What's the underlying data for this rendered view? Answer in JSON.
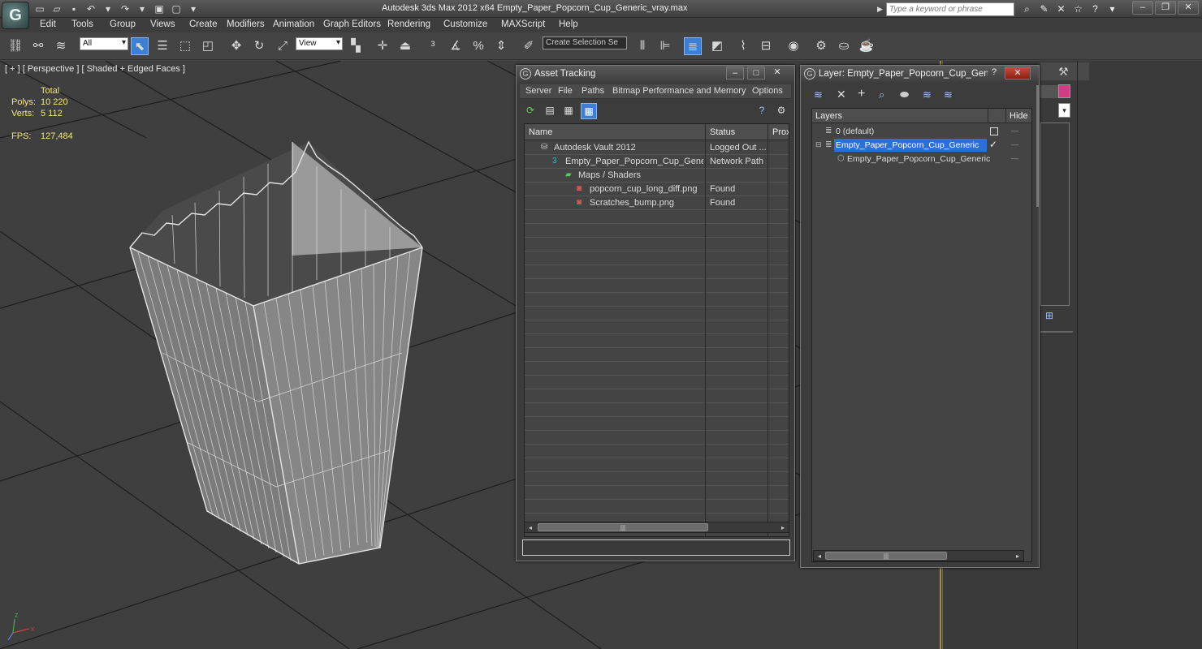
{
  "titlebar": {
    "logo_letter": "G",
    "title": "Autodesk 3ds Max  2012 x64     Empty_Paper_Popcorn_Cup_Generic_vray.max",
    "search_placeholder": "Type a keyword or phrase"
  },
  "menu": [
    "Edit",
    "Tools",
    "Group",
    "Views",
    "Create",
    "Modifiers",
    "Animation",
    "Graph Editors",
    "Rendering",
    "Customize",
    "MAXScript",
    "Help"
  ],
  "toolbar": {
    "selection_filter": "All",
    "ref_coord": "View",
    "named_selection_placeholder": "Create Selection Se"
  },
  "viewport": {
    "label": "[ + ] [ Perspective ] [ Shaded + Edged Faces ]",
    "stats": {
      "total_label": "Total",
      "polys_label": "Polys:",
      "polys_value": "10 220",
      "verts_label": "Verts:",
      "verts_value": "5 112",
      "fps_label": "FPS:",
      "fps_value": "127,484"
    }
  },
  "asset_tracking": {
    "title": "Asset Tracking",
    "menu": [
      "Server",
      "File",
      "Paths",
      "Bitmap Performance and Memory",
      "Options"
    ],
    "columns": [
      "Name",
      "Status",
      "Prox"
    ],
    "rows": [
      {
        "name": "Autodesk Vault 2012",
        "status": "Logged Out ..."
      },
      {
        "name": "Empty_Paper_Popcorn_Cup_Gener...",
        "status": "Network Path"
      },
      {
        "name": "Maps / Shaders",
        "status": ""
      },
      {
        "name": "popcorn_cup_long_diff.png",
        "status": "Found"
      },
      {
        "name": "Scratches_bump.png",
        "status": "Found"
      }
    ]
  },
  "layer_window": {
    "title": "Layer: Empty_Paper_Popcorn_Cup_Generic",
    "columns": [
      "Layers",
      "Hide"
    ],
    "rows": [
      {
        "name": "0 (default)"
      },
      {
        "name": "Empty_Paper_Popcorn_Cup_Generic"
      },
      {
        "name": "Empty_Paper_Popcorn_Cup_Generic"
      }
    ]
  }
}
